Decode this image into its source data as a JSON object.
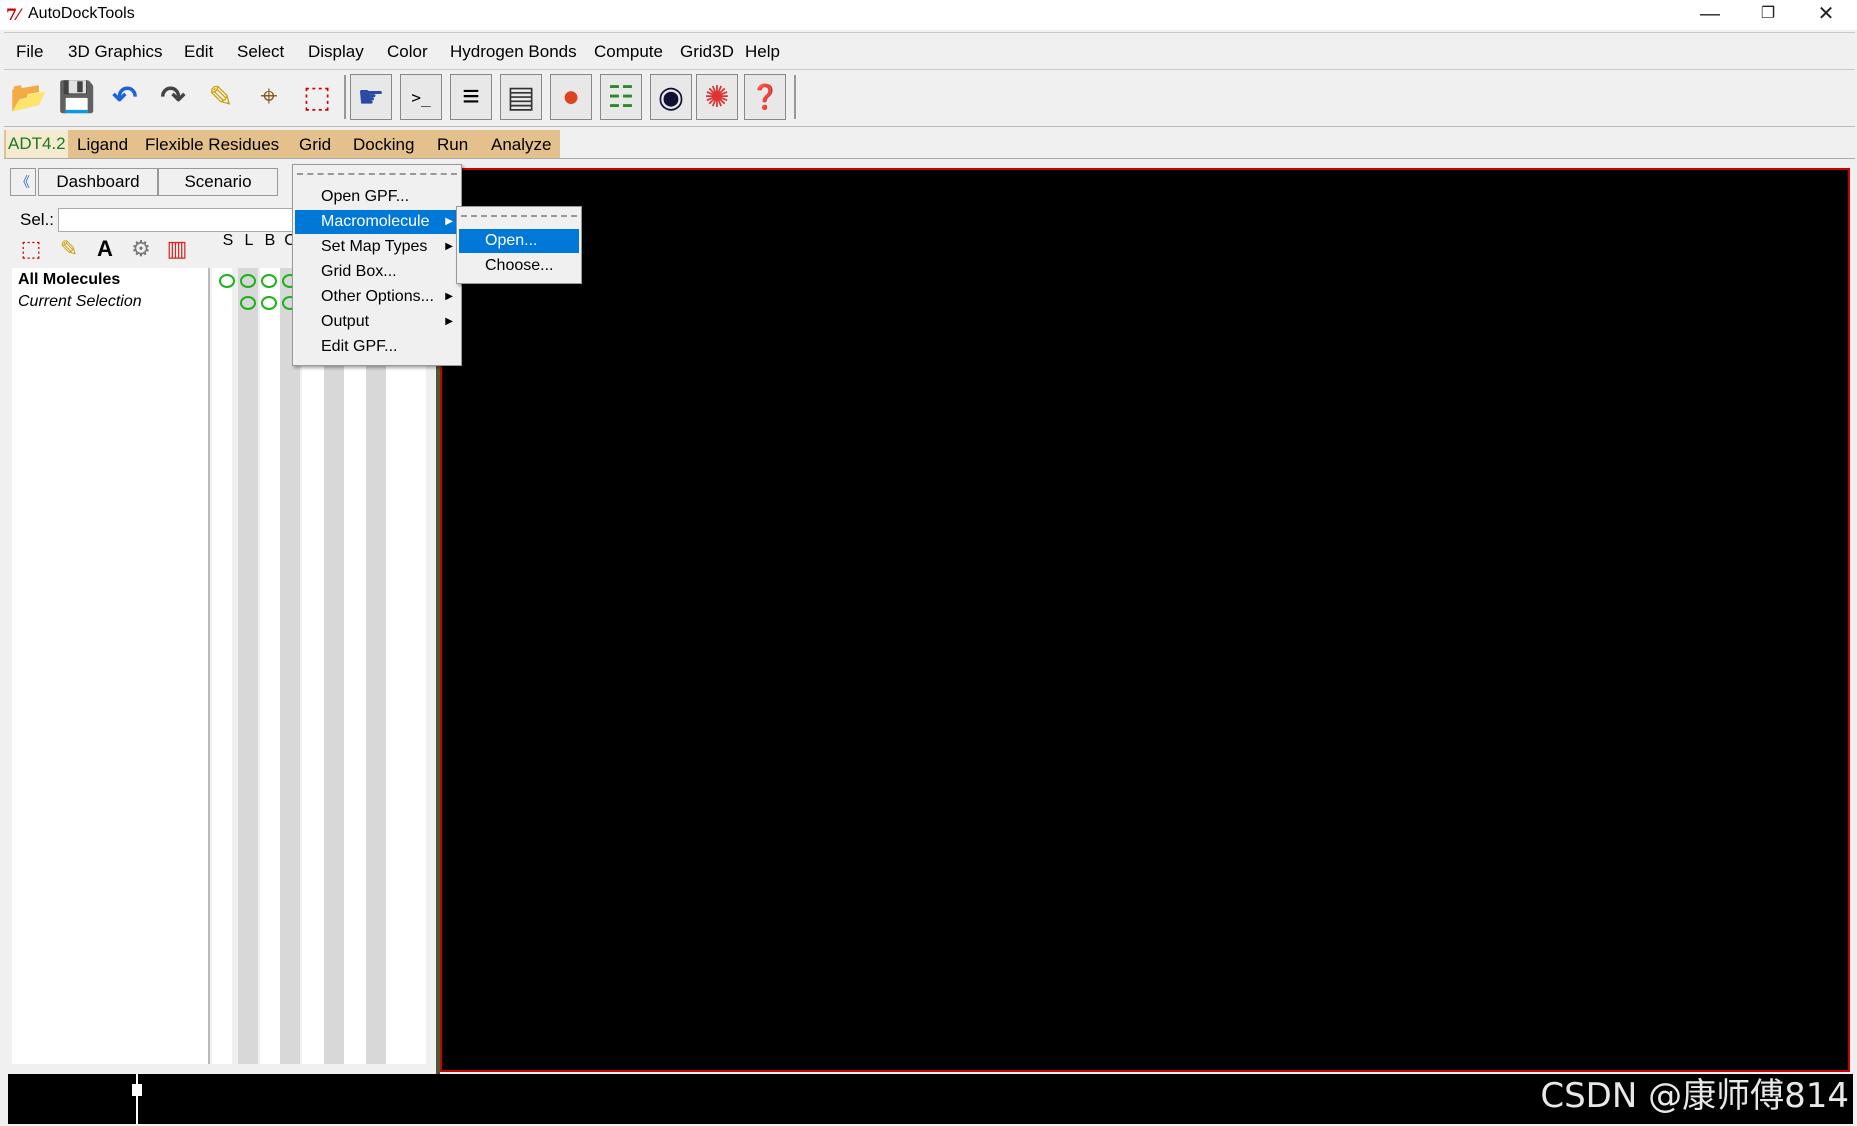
{
  "window": {
    "title": "AutoDockTools",
    "app_icon": "tk-icon",
    "minimize": "—",
    "restore": "❐",
    "close": "✕"
  },
  "menubar": [
    "File",
    "3D Graphics",
    "Edit",
    "Select",
    "Display",
    "Color",
    "Hydrogen Bonds",
    "Compute",
    "Grid3D",
    "Help"
  ],
  "toolbar": [
    {
      "icon": "open-folder-icon",
      "glyph": "📂"
    },
    {
      "icon": "save-icon",
      "glyph": "💾"
    },
    {
      "icon": "undo-icon",
      "glyph": "↶"
    },
    {
      "icon": "redo-icon",
      "glyph": "↷"
    },
    {
      "icon": "color-pencil-icon",
      "glyph": "✎"
    },
    {
      "icon": "center-target-icon",
      "glyph": "⌖"
    },
    {
      "icon": "selection-icon",
      "glyph": "⬚"
    },
    {
      "icon": "pick-hand-icon",
      "glyph": "☛"
    },
    {
      "icon": "python-shell-icon",
      "glyph": ">_"
    },
    {
      "icon": "text-log-icon",
      "glyph": "≡"
    },
    {
      "icon": "dashboard-icon",
      "glyph": "▤"
    },
    {
      "icon": "color-blob-icon",
      "glyph": "●"
    },
    {
      "icon": "hierarchy-icon",
      "glyph": "☷"
    },
    {
      "icon": "stereo-glasses-icon",
      "glyph": "◉"
    },
    {
      "icon": "surface-icon",
      "glyph": "✺"
    },
    {
      "icon": "help-balloon-icon",
      "glyph": "❓"
    }
  ],
  "adt_tabs": [
    "ADT4.2",
    "Ligand",
    "Flexible Residues",
    "Grid",
    "Docking",
    "Run",
    "Analyze"
  ],
  "left_panel": {
    "collapse_glyph": "《",
    "tabs": [
      "Dashboard",
      "Scenario"
    ],
    "sel_label": "Sel.:",
    "sel_value": "",
    "tools": [
      "select-tool-icon",
      "pencil-tool-icon",
      "label-tool-icon",
      "gear-tool-icon",
      "bars-tool-icon"
    ],
    "tool_glyphs": [
      "⬚",
      "✎",
      "A",
      "⚙",
      "▥"
    ],
    "column_headers": [
      "S",
      "L",
      "B",
      "C"
    ],
    "tree": [
      {
        "label": "All Molecules"
      },
      {
        "label": "Current Selection"
      }
    ]
  },
  "grid_menu": {
    "items": [
      {
        "label": "Open GPF...",
        "submenu": false
      },
      {
        "label": "Macromolecule",
        "submenu": true,
        "highlighted": true
      },
      {
        "label": "Set Map Types",
        "submenu": true
      },
      {
        "label": "Grid Box...",
        "submenu": false
      },
      {
        "label": "Other Options...",
        "submenu": true
      },
      {
        "label": "Output",
        "submenu": true
      },
      {
        "label": "Edit GPF...",
        "submenu": false
      }
    ]
  },
  "macromolecule_submenu": {
    "items": [
      {
        "label": "Open...",
        "highlighted": true
      },
      {
        "label": "Choose..."
      }
    ]
  },
  "watermark": "CSDN @康师傅814",
  "colors": {
    "accent": "#0078d7",
    "adt_strip": "#e4c18c",
    "viewer_border": "#cc0000",
    "active_tab_text": "#1d7a1d"
  }
}
